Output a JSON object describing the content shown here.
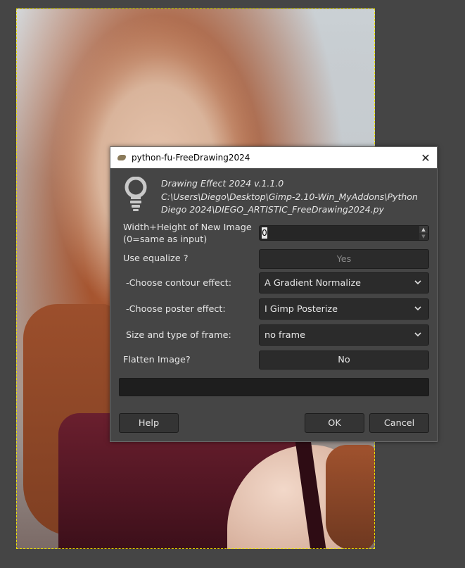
{
  "dialog": {
    "title": "python-fu-FreeDrawing2024",
    "close_glyph": "✕",
    "description_lines": [
      "Drawing Effect 2024 v.1.1.0",
      "C:\\Users\\Diego\\Desktop\\Gimp-2.10-Win_MyAddons\\Python",
      "Diego 2024\\DIEGO_ARTISTIC_FreeDrawing2024.py"
    ],
    "fields": {
      "size_label_line1": "Width+Height of New Image",
      "size_label_line2": " (0=same as input)",
      "size_value": "0",
      "equalize_label": "Use equalize ?",
      "equalize_value": "Yes",
      "contour_label": "-Choose contour effect:",
      "contour_value": "A Gradient Normalize",
      "poster_label": "-Choose poster effect:",
      "poster_value": "I Gimp Posterize",
      "frame_label": "Size and type of frame:",
      "frame_value": "no frame",
      "flatten_label": "Flatten Image?",
      "flatten_value": "No"
    },
    "progress": 0,
    "buttons": {
      "help": "Help",
      "ok": "OK",
      "cancel": "Cancel"
    }
  },
  "icons": {
    "bulb": "lightbulb-icon",
    "chevron": "chevron-down-icon",
    "app": "gimp-icon"
  },
  "colors": {
    "selection_border": "#e8e000",
    "dialog_bg": "#454545"
  }
}
